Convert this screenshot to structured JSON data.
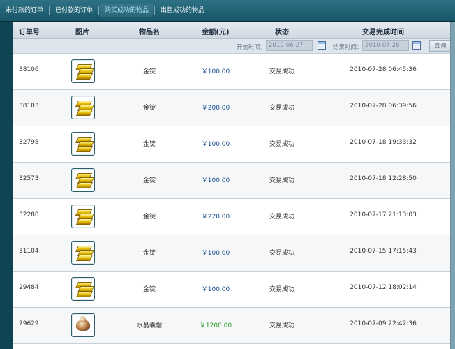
{
  "tabs": [
    {
      "label": "未付款的订单",
      "active": false
    },
    {
      "label": "已付款的订单",
      "active": false
    },
    {
      "label": "购买成功的物品",
      "active": true
    },
    {
      "label": "出售成功的物品",
      "active": false
    }
  ],
  "table": {
    "columns": [
      "订单号",
      "图片",
      "物品名",
      "金额(元)",
      "状态",
      "交易完成时间"
    ]
  },
  "filter": {
    "start_label": "开始时间：",
    "start_value": "2010-06-27",
    "end_label": "结束时间：",
    "end_value": "2010-07-28",
    "query_label": "查询"
  },
  "orders": [
    {
      "id": "38106",
      "item": "金锭",
      "amount": "￥100.00",
      "status": "交易成功",
      "time": "2010-07-28 06:45:36",
      "icon": "gold-ingot-icon"
    },
    {
      "id": "38103",
      "item": "金锭",
      "amount": "￥200.00",
      "status": "交易成功",
      "time": "2010-07-28 06:39:56",
      "icon": "gold-ingot-icon"
    },
    {
      "id": "32798",
      "item": "金锭",
      "amount": "￥100.00",
      "status": "交易成功",
      "time": "2010-07-18 19:33:32",
      "icon": "gold-ingot-icon"
    },
    {
      "id": "32573",
      "item": "金锭",
      "amount": "￥100.00",
      "status": "交易成功",
      "time": "2010-07-18 12:28:50",
      "icon": "gold-ingot-icon"
    },
    {
      "id": "32280",
      "item": "金锭",
      "amount": "￥220.00",
      "status": "交易成功",
      "time": "2010-07-17 21:13:03",
      "icon": "gold-ingot-icon"
    },
    {
      "id": "31104",
      "item": "金锭",
      "amount": "￥100.00",
      "status": "交易成功",
      "time": "2010-07-15 17:15:43",
      "icon": "gold-ingot-icon"
    },
    {
      "id": "29484",
      "item": "金锭",
      "amount": "￥100.00",
      "status": "交易成功",
      "time": "2010-07-12 18:02:14",
      "icon": "gold-ingot-icon"
    },
    {
      "id": "29629",
      "item": "水晶囊帽",
      "amount": "￥1200.00",
      "status": "交易成功",
      "time": "2010-07-09 22:42:36",
      "icon": "crystal-hat-icon"
    }
  ],
  "colors": {
    "topbar": "#185668",
    "header": "#dfe5ec",
    "amount_blue": "#1a4f8f",
    "amount_green": "#2b9b27"
  }
}
